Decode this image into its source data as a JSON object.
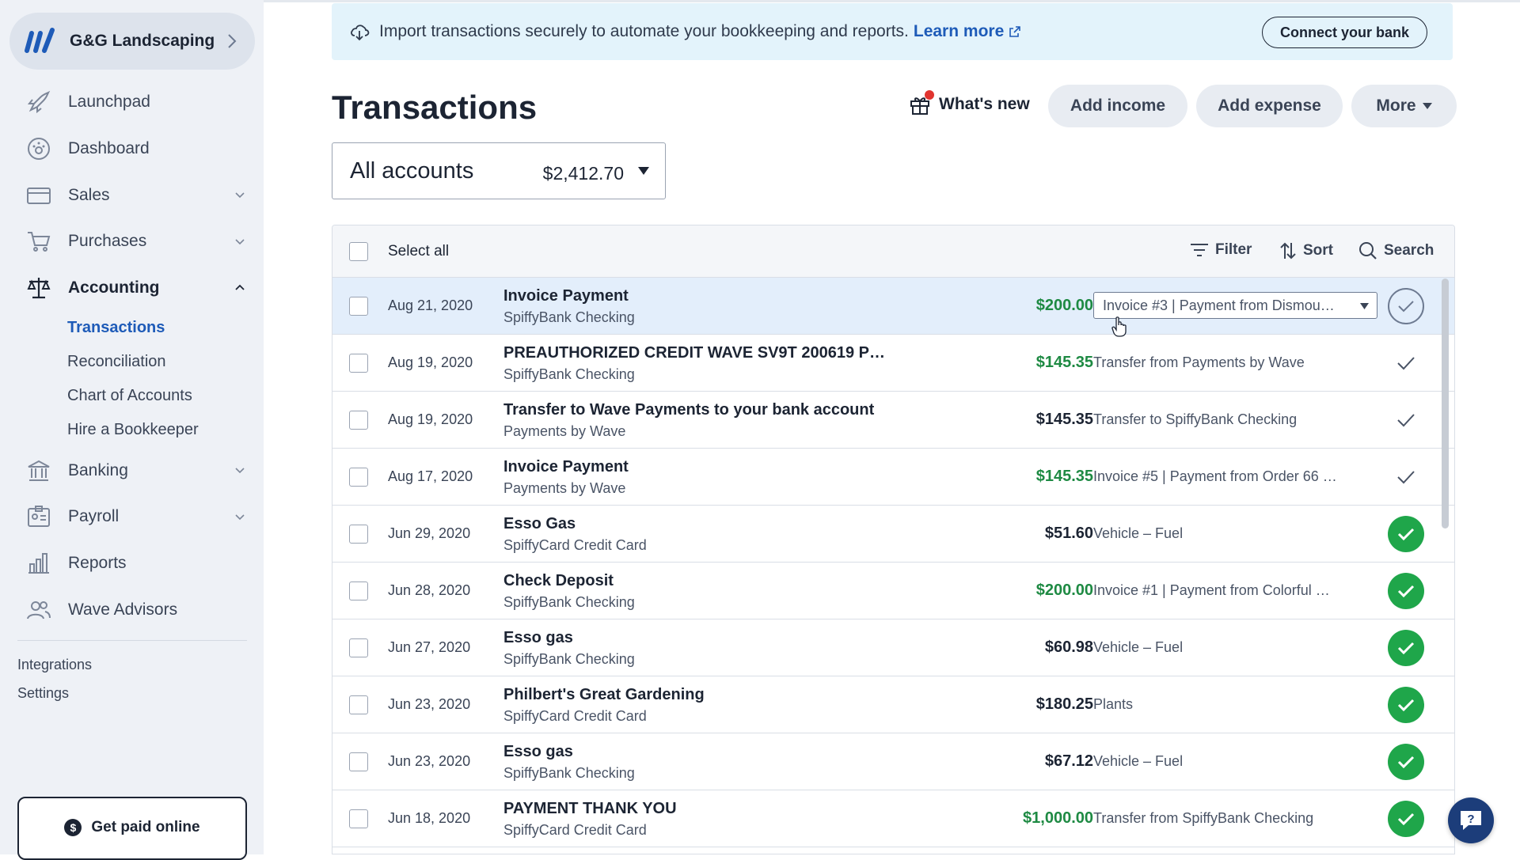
{
  "sidebar": {
    "business_name": "G&G Landscaping",
    "nav": [
      {
        "label": "Launchpad",
        "icon": "rocket-icon"
      },
      {
        "label": "Dashboard",
        "icon": "dashboard-icon"
      },
      {
        "label": "Sales",
        "icon": "sales-card-icon"
      },
      {
        "label": "Purchases",
        "icon": "cart-icon"
      },
      {
        "label": "Accounting",
        "icon": "scale-icon"
      },
      {
        "label": "Banking",
        "icon": "bank-icon"
      },
      {
        "label": "Payroll",
        "icon": "payroll-icon"
      },
      {
        "label": "Reports",
        "icon": "reports-icon"
      },
      {
        "label": "Wave Advisors",
        "icon": "advisors-icon"
      }
    ],
    "accounting_sub": [
      "Transactions",
      "Reconciliation",
      "Chart of Accounts",
      "Hire a Bookkeeper"
    ],
    "integrations": "Integrations",
    "settings": "Settings",
    "get_paid": "Get paid online"
  },
  "banner": {
    "text": "Import transactions securely to automate your bookkeeping and reports.",
    "link": "Learn more",
    "button": "Connect your bank"
  },
  "header": {
    "title": "Transactions",
    "whats_new": "What's new",
    "add_income": "Add income",
    "add_expense": "Add expense",
    "more": "More"
  },
  "account_selector": {
    "name": "All accounts",
    "balance": "$2,412.70"
  },
  "table": {
    "select_all": "Select  all",
    "filter": "Filter",
    "sort": "Sort",
    "search": "Search",
    "rows": [
      {
        "date": "Aug 21, 2020",
        "desc": "Invoice Payment",
        "account": "SpiffyBank Checking",
        "amount": "$200.00",
        "category": "Invoice #3 | Payment from Dismou…"
      },
      {
        "date": "Aug 19, 2020",
        "desc": "PREAUTHORIZED CREDIT WAVE SV9T 200619 P…",
        "account": "SpiffyBank Checking",
        "amount": "$145.35",
        "category": "Transfer from Payments by Wave"
      },
      {
        "date": "Aug 19, 2020",
        "desc": "Transfer to Wave Payments to your bank account",
        "account": "Payments by Wave",
        "amount": "$145.35",
        "category": "Transfer to SpiffyBank Checking"
      },
      {
        "date": "Aug 17, 2020",
        "desc": "Invoice Payment",
        "account": "Payments by Wave",
        "amount": "$145.35",
        "category": "Invoice #5 | Payment from Order 66 …"
      },
      {
        "date": "Jun 29, 2020",
        "desc": "Esso Gas",
        "account": "SpiffyCard Credit Card",
        "amount": "$51.60",
        "category": "Vehicle – Fuel"
      },
      {
        "date": "Jun 28, 2020",
        "desc": "Check Deposit",
        "account": "SpiffyBank Checking",
        "amount": "$200.00",
        "category": "Invoice #1 | Payment from Colorful …"
      },
      {
        "date": "Jun 27, 2020",
        "desc": "Esso gas",
        "account": "SpiffyBank Checking",
        "amount": "$60.98",
        "category": "Vehicle – Fuel"
      },
      {
        "date": "Jun 23, 2020",
        "desc": "Philbert's Great Gardening",
        "account": "SpiffyCard Credit Card",
        "amount": "$180.25",
        "category": "Plants"
      },
      {
        "date": "Jun 23, 2020",
        "desc": "Esso gas",
        "account": "SpiffyBank Checking",
        "amount": "$67.12",
        "category": "Vehicle – Fuel"
      },
      {
        "date": "Jun 18, 2020",
        "desc": "PAYMENT THANK YOU",
        "account": "SpiffyCard Credit Card",
        "amount": "$1,000.00",
        "category": "Transfer from SpiffyBank Checking"
      }
    ]
  },
  "colors": {
    "income_green": "#1e8a43",
    "reviewed_green": "#1fa64a",
    "link_blue": "#1e5bb8",
    "banner_bg": "#e3f3fb",
    "selected_row_bg": "#e3eefb"
  }
}
